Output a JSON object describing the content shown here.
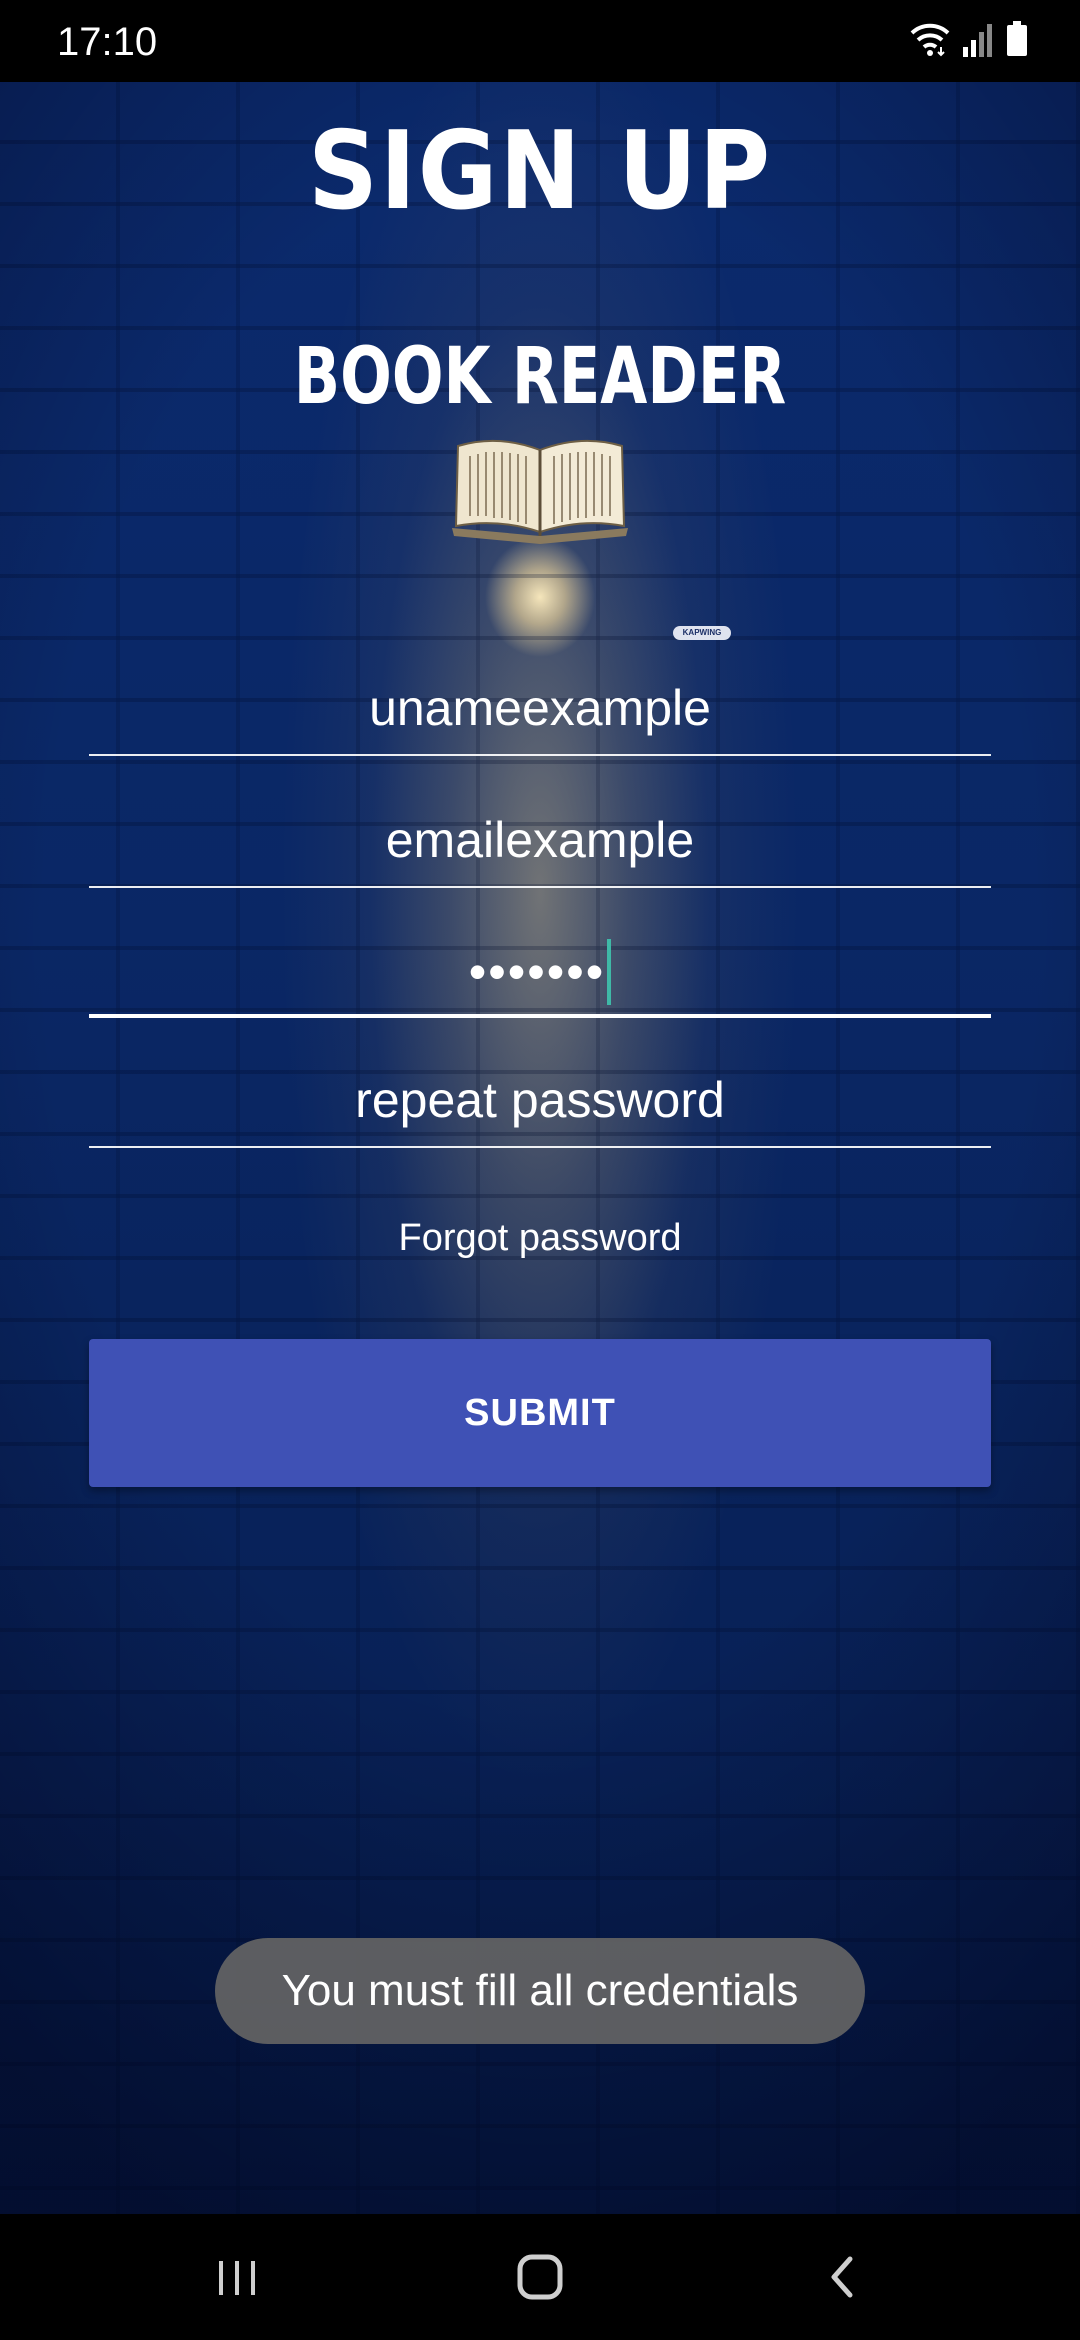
{
  "status_bar": {
    "time": "17:10",
    "icons": [
      "wifi-icon",
      "signal-icon",
      "battery-icon"
    ]
  },
  "header": {
    "title": "SIGN UP",
    "app_name": "BOOK READER",
    "illustration": "open-book-icon",
    "watermark": "KAPWING"
  },
  "form": {
    "username": {
      "value": "unameexample"
    },
    "email": {
      "value": "emailexample"
    },
    "password": {
      "value": "•••••••",
      "focused": true
    },
    "repeat_password": {
      "placeholder": "repeat password"
    }
  },
  "forgot_password_label": "Forgot password",
  "submit_label": "SUBMIT",
  "toast": "You must fill all credentials",
  "nav_bar": {
    "buttons": [
      "recent-apps-icon",
      "home-icon",
      "back-icon"
    ]
  },
  "colors": {
    "accent": "#3f51b5",
    "background": "#0a2765",
    "caret": "#3fb9a7",
    "toast_bg": "#646464"
  }
}
